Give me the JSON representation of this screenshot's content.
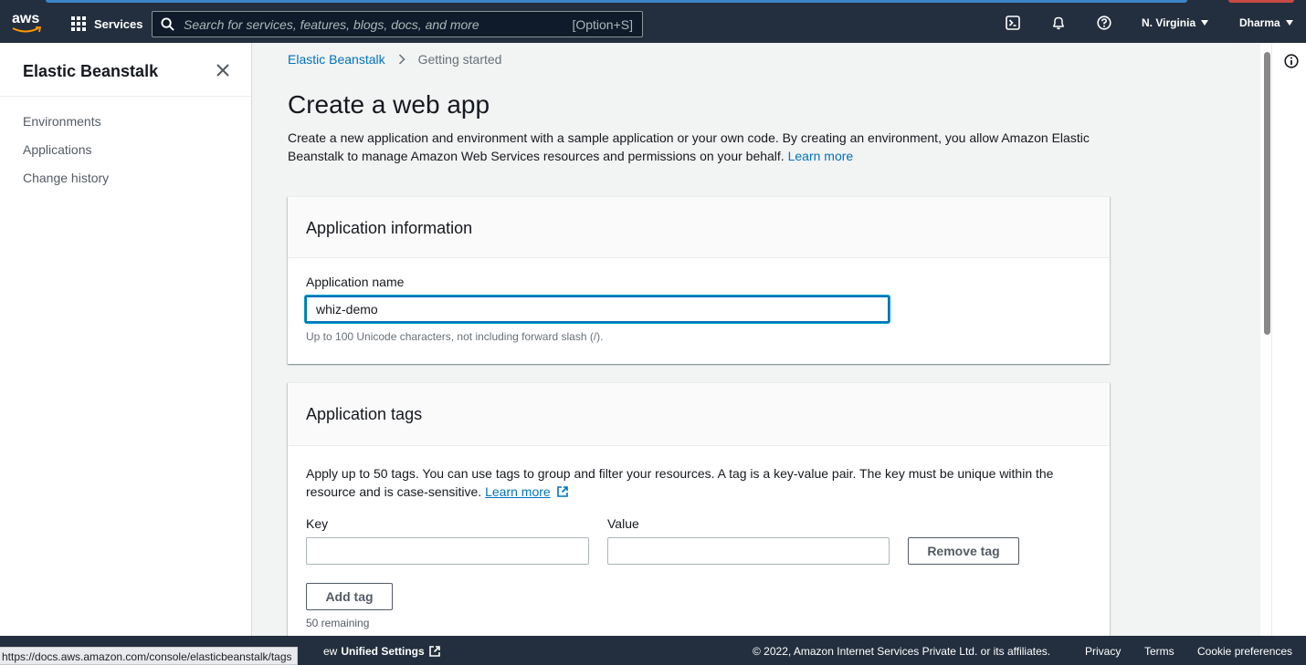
{
  "topnav": {
    "logo_text": "aws",
    "services_label": "Services",
    "search_placeholder": "Search for services, features, blogs, docs, and more",
    "search_shortcut": "[Option+S]",
    "region_label": "N. Virginia",
    "user_label": "Dharma",
    "icons": [
      "cloudshell-icon",
      "bell-icon",
      "help-icon"
    ]
  },
  "sidebar": {
    "title": "Elastic Beanstalk",
    "items": [
      {
        "label": "Environments"
      },
      {
        "label": "Applications"
      },
      {
        "label": "Change history"
      }
    ]
  },
  "breadcrumb": {
    "root": "Elastic Beanstalk",
    "current": "Getting started"
  },
  "page": {
    "title": "Create a web app",
    "intro": "Create a new application and environment with a sample application or your own code. By creating an environment, you allow Amazon Elastic Beanstalk to manage Amazon Web Services resources and permissions on your behalf.",
    "intro_link": "Learn more"
  },
  "app_info": {
    "heading": "Application information",
    "name_label": "Application name",
    "name_value": "whiz-demo",
    "name_hint": "Up to 100 Unicode characters, not including forward slash (/)."
  },
  "app_tags": {
    "heading": "Application tags",
    "description": "Apply up to 50 tags. You can use tags to group and filter your resources. A tag is a key-value pair. The key must be unique within the resource and is case-sensitive.",
    "description_link": "Learn more",
    "key_label": "Key",
    "value_label": "Value",
    "key_value": "",
    "value_value": "",
    "remove_button": "Remove tag",
    "add_button": "Add tag",
    "remaining": "50 remaining"
  },
  "footer": {
    "settings_partial": "ew",
    "settings_label": "Unified Settings",
    "copyright": "© 2022, Amazon Internet Services Private Ltd. or its affiliates.",
    "privacy": "Privacy",
    "terms": "Terms",
    "cookies": "Cookie preferences"
  },
  "status_bar": {
    "url": "https://docs.aws.amazon.com/console/elasticbeanstalk/tags"
  },
  "colors": {
    "nav_bg": "#232f3e",
    "link": "#0073bb",
    "focus": "#0073bb",
    "page_bg": "#f2f3f3"
  }
}
